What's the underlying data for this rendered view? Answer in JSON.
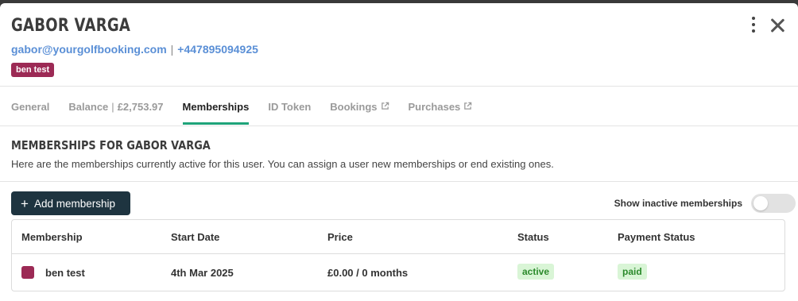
{
  "user": {
    "name": "GABOR VARGA",
    "email": "gabor@yourgolfbooking.com",
    "phone": "+447895094925",
    "tag": "ben test"
  },
  "tabs": [
    {
      "label": "General"
    },
    {
      "label": "Balance",
      "value": "£2,753.97"
    },
    {
      "label": "Memberships",
      "active": true
    },
    {
      "label": "ID Token"
    },
    {
      "label": "Bookings",
      "external": true
    },
    {
      "label": "Purchases",
      "external": true
    }
  ],
  "section": {
    "title": "MEMBERSHIPS FOR GABOR VARGA",
    "description": "Here are the memberships currently active for this user. You can assign a user new memberships or end existing ones."
  },
  "toolbar": {
    "add_label": "Add membership",
    "toggle_label": "Show inactive memberships",
    "toggle_on": false
  },
  "table": {
    "columns": [
      "Membership",
      "Start Date",
      "Price",
      "Status",
      "Payment Status"
    ],
    "rows": [
      {
        "membership": "ben test",
        "color": "#9c2a55",
        "start_date": "4th Mar 2025",
        "price": "£0.00 / 0 months",
        "status": "active",
        "payment_status": "paid"
      }
    ]
  },
  "icons": {
    "menu": "kebab-menu-icon",
    "close": "close-icon",
    "external": "external-link-icon",
    "add": "plus-icon"
  },
  "colors": {
    "accent": "#1fa37a",
    "primary_button": "#1e3440",
    "link": "#5a8fd6",
    "tag": "#9c2a55"
  }
}
